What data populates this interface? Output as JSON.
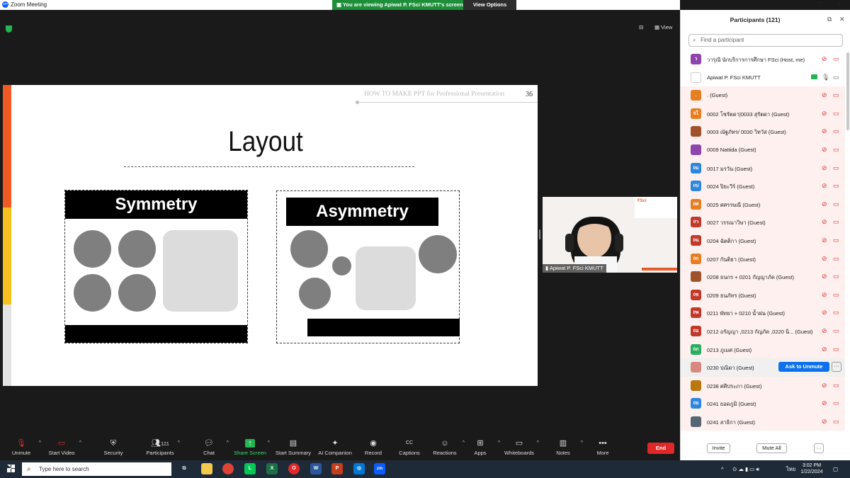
{
  "window": {
    "title": "Zoom Meeting",
    "sharing_banner": "You are viewing Apiwat P. FSci KMUTT's screen",
    "view_options": "View Options",
    "view_label": "View"
  },
  "slide": {
    "header_text": "HOW TO MAKE PPT for Professional Presentation",
    "page_number": "36",
    "title": "Layout",
    "symmetry_label": "Symmetry",
    "asymmetry_label": "Asymmetry"
  },
  "video": {
    "name": "Apiwat P. FSci KMUTT",
    "logo_text": "FSci"
  },
  "toolbar": {
    "unmute": "Unmute",
    "start_video": "Start Video",
    "security": "Security",
    "participants": "Participants",
    "participants_count": "121",
    "chat": "Chat",
    "share_screen": "Share Screen",
    "start_summary": "Start Summary",
    "ai_companion": "AI Companion",
    "record": "Record",
    "captions": "Captions",
    "reactions": "Reactions",
    "apps": "Apps",
    "whiteboards": "Whiteboards",
    "notes": "Notes",
    "more": "More",
    "end": "End"
  },
  "panel": {
    "title": "Participants (121)",
    "search_placeholder": "Find a participant",
    "ask_to_unmute": "Ask to Unmute",
    "invite": "Invite",
    "mute_all": "Mute All",
    "participants": [
      {
        "avatar": "ว",
        "color": "#8e44ad",
        "name": "วารุณี นักบริการการศึกษา FSci (Host, me)"
      },
      {
        "avatar": "",
        "color": "#ffffff",
        "name": "Apiwat P. FSci KMUTT"
      },
      {
        "avatar": ".",
        "color": "#e67e22",
        "name": ". (Guest)"
      },
      {
        "avatar": "0โ",
        "color": "#e67e22",
        "name": "0002 โชรัตดา|0033 สุรัตดา (Guest)"
      },
      {
        "avatar": "",
        "color": "#a0522d",
        "name": "0003 ณัฐภัทร/ 0030 วิทวัส (Guest)"
      },
      {
        "avatar": "",
        "color": "#8e44ad",
        "name": "0009 Nattida (Guest)"
      },
      {
        "avatar": "0ม",
        "color": "#2e86de",
        "name": "0017 มรวัน (Guest)"
      },
      {
        "avatar": "0ป",
        "color": "#2e86de",
        "name": "0024 ปิยะวีร์ (Guest)"
      },
      {
        "avatar": "0ศ",
        "color": "#e67e22",
        "name": "0025 ศศรรษณี (Guest)"
      },
      {
        "avatar": "0ว",
        "color": "#c0392b",
        "name": "0027 วรรณาวิษา (Guest)"
      },
      {
        "avatar": "0ฉ",
        "color": "#c0392b",
        "name": "0204 ฉัตติกา (Guest)"
      },
      {
        "avatar": "0ก",
        "color": "#e67e22",
        "name": "0207 กันติยา (Guest)"
      },
      {
        "avatar": "",
        "color": "#a0522d",
        "name": "0208 ธนกร + 0201 กัญญาภัค (Guest)"
      },
      {
        "avatar": "0ธ",
        "color": "#c0392b",
        "name": "0209 ธนภัทร (Guest)"
      },
      {
        "avatar": "0พ",
        "color": "#c0392b",
        "name": "0211 พัทยา + 0210 น้ำฝน (Guest)"
      },
      {
        "avatar": "0อ",
        "color": "#c0392b",
        "name": "0212 อรัญญา ,0213 กัญภัค ,0220 นิ... (Guest)"
      },
      {
        "avatar": "0ภ",
        "color": "#27ae60",
        "name": "0213 ภูเมศ (Guest)"
      },
      {
        "avatar": "",
        "color": "#d98880",
        "name": "0230 ปณิดา (Guest)"
      },
      {
        "avatar": "",
        "color": "#b9770e",
        "name": "0238 ศศิประภา (Guest)"
      },
      {
        "avatar": "0ย",
        "color": "#2e86de",
        "name": "0241 ยอดภูมิ (Guest)"
      },
      {
        "avatar": "",
        "color": "#566573",
        "name": "0241 สาธิกา (Guest)"
      }
    ]
  },
  "taskbar": {
    "search_placeholder": "Type here to search",
    "time": "3:02 PM",
    "date": "1/22/2024",
    "lang": "ไทย"
  }
}
